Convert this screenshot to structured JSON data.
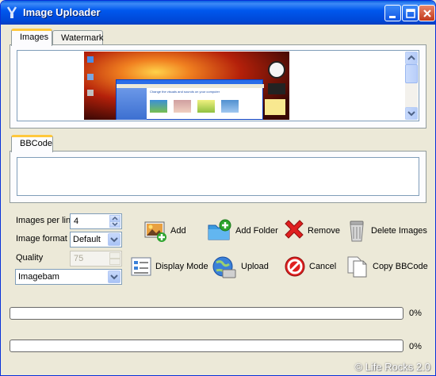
{
  "window": {
    "title": "Image Uploader"
  },
  "tabs_top": [
    {
      "label": "Images",
      "active": true
    },
    {
      "label": "Watermark",
      "active": false
    }
  ],
  "tabs_bottom": [
    {
      "label": "BBCode",
      "active": true
    }
  ],
  "preview_window": {
    "heading": "Change the visuals and sounds on your computer",
    "desktop_tabs": [
      "Themes",
      "Desktop",
      "Screen Saver",
      "Appearance",
      "Settings"
    ]
  },
  "settings": {
    "images_per_line_label": "Images per line",
    "images_per_line_value": "4",
    "image_format_label": "Image format",
    "image_format_value": "Default",
    "quality_label": "Quality",
    "quality_value": "75",
    "host_value": "Imagebam"
  },
  "actions": {
    "add": "Add",
    "add_folder": "Add Folder",
    "remove": "Remove",
    "delete_images": "Delete Images",
    "display_mode": "Display Mode",
    "upload": "Upload",
    "cancel": "Cancel",
    "copy_bbcode": "Copy BBCode"
  },
  "progress": [
    {
      "value_label": "0%",
      "fraction": 0
    },
    {
      "value_label": "0%",
      "fraction": 0
    }
  ],
  "watermark": "© Life Rocks 2.0",
  "colors": {
    "titlebar": "#0058ee",
    "tab_highlight": "#ffc83c",
    "window_bg": "#ece9d8"
  },
  "icons": {
    "app": "app-icon",
    "minimize": "minimize-icon",
    "maximize": "maximize-icon",
    "close": "close-icon",
    "add": "add-image-icon",
    "add_folder": "folder-add-icon",
    "remove": "remove-x-icon",
    "delete": "recycle-bin-icon",
    "display_mode": "display-mode-icon",
    "upload": "upload-globe-icon",
    "cancel": "cancel-icon",
    "copy": "copy-document-icon"
  }
}
